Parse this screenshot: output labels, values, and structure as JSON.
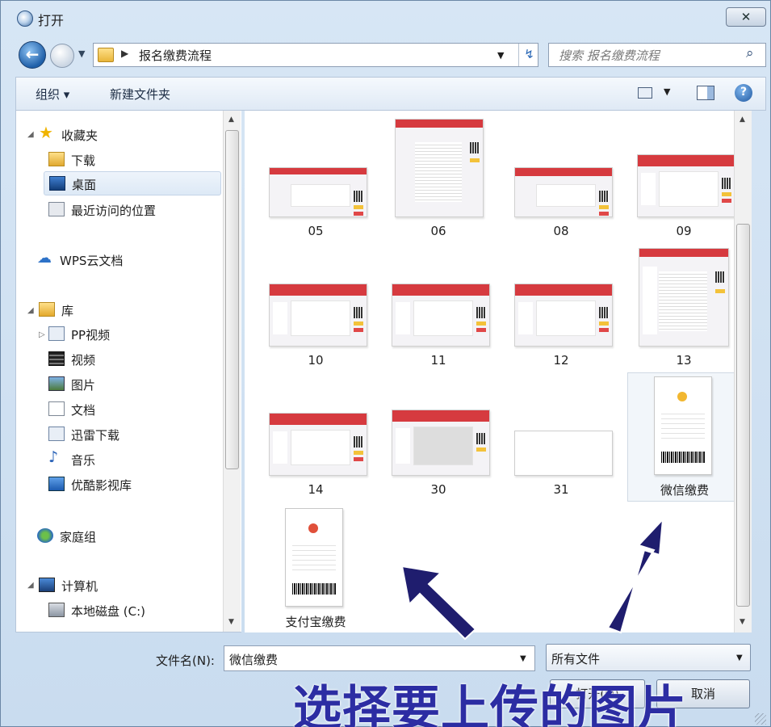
{
  "window": {
    "title": "打开",
    "close_label": "✕"
  },
  "nav": {
    "address_path": "报名缴费流程",
    "search_placeholder": "搜索 报名缴费流程"
  },
  "toolbar": {
    "organize_label": "组织 ▾",
    "new_folder_label": "新建文件夹"
  },
  "sidebar": {
    "items": [
      {
        "label": "收藏夹",
        "icon": "star-icon"
      },
      {
        "label": "下载",
        "icon": "download-folder-icon"
      },
      {
        "label": "桌面",
        "icon": "desktop-icon",
        "selected": true
      },
      {
        "label": "最近访问的位置",
        "icon": "recent-places-icon"
      },
      {
        "label": "WPS云文档",
        "icon": "cloud-icon"
      },
      {
        "label": "库",
        "icon": "library-icon"
      },
      {
        "label": "PP视频",
        "icon": "pp-video-icon"
      },
      {
        "label": "视频",
        "icon": "video-icon"
      },
      {
        "label": "图片",
        "icon": "pictures-icon"
      },
      {
        "label": "文档",
        "icon": "documents-icon"
      },
      {
        "label": "迅雷下载",
        "icon": "thunder-download-icon"
      },
      {
        "label": "音乐",
        "icon": "music-icon"
      },
      {
        "label": "优酷影视库",
        "icon": "youku-icon"
      },
      {
        "label": "家庭组",
        "icon": "homegroup-icon"
      },
      {
        "label": "计算机",
        "icon": "computer-icon"
      },
      {
        "label": "本地磁盘 (C:)",
        "icon": "disk-icon"
      }
    ]
  },
  "files": [
    {
      "name": "05"
    },
    {
      "name": "06"
    },
    {
      "name": "08"
    },
    {
      "name": "09"
    },
    {
      "name": "10"
    },
    {
      "name": "11"
    },
    {
      "name": "12"
    },
    {
      "name": "13"
    },
    {
      "name": "14"
    },
    {
      "name": "30"
    },
    {
      "name": "31"
    },
    {
      "name": "微信缴费",
      "selected": true
    },
    {
      "name": "支付宝缴费"
    }
  ],
  "bottom": {
    "filename_label": "文件名(N):",
    "filename_value": "微信缴费",
    "filetype_value": "所有文件",
    "open_label": "打开(O)",
    "cancel_label": "取消"
  },
  "annotation": {
    "text": "选择要上传的图片",
    "color": "#2c2da3"
  },
  "colors": {
    "accent": "#d63a3f",
    "selection": "#dde9f6"
  }
}
